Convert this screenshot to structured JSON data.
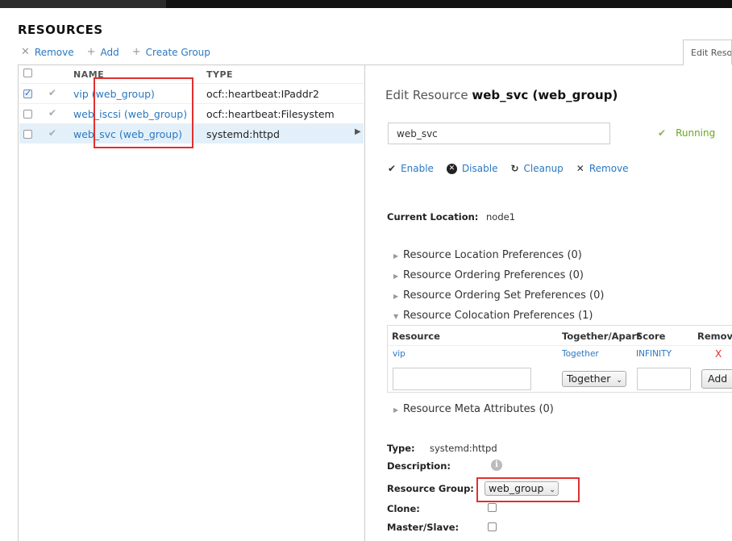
{
  "page": {
    "title": "RESOURCES"
  },
  "toolbar": {
    "remove_label": "Remove",
    "add_label": "Add",
    "create_group_label": "Create Group"
  },
  "tab": {
    "label": "Edit Resou"
  },
  "list": {
    "headers": {
      "name": "NAME",
      "type": "TYPE"
    },
    "rows": [
      {
        "name": "vip (web_group)",
        "type": "ocf::heartbeat:IPaddr2",
        "checked": true,
        "selected": false
      },
      {
        "name": "web_iscsi (web_group)",
        "type": "ocf::heartbeat:Filesystem",
        "checked": false,
        "selected": false
      },
      {
        "name": "web_svc (web_group)",
        "type": "systemd:httpd",
        "checked": false,
        "selected": true
      }
    ]
  },
  "edit": {
    "title_prefix": "Edit Resource ",
    "title_name": "web_svc (web_group)",
    "name_value": "web_svc",
    "status": "Running",
    "actions": {
      "enable": "Enable",
      "disable": "Disable",
      "cleanup": "Cleanup",
      "remove": "Remove"
    },
    "current_location_label": "Current Location:",
    "current_location_value": "node1",
    "prefs": {
      "location": "Resource Location Preferences (0)",
      "ordering": "Resource Ordering Preferences (0)",
      "ordering_set": "Resource Ordering Set Preferences (0)",
      "colocation": "Resource Colocation Preferences (1)",
      "meta": "Resource Meta Attributes (0)"
    },
    "colocation_table": {
      "headers": {
        "resource": "Resource",
        "together": "Together/Apart",
        "score": "Score",
        "remove": "Remove"
      },
      "row": {
        "resource": "vip",
        "together": "Together",
        "score": "INFINITY",
        "remove": "X"
      },
      "new_select": "Together",
      "add_button": "Add"
    },
    "type_label": "Type:",
    "type_value": "systemd:httpd",
    "description_label": "Description:",
    "resource_group_label": "Resource Group:",
    "resource_group_value": "web_group",
    "clone_label": "Clone:",
    "master_slave_label": "Master/Slave:"
  },
  "colors": {
    "link": "#2a78c0",
    "running": "#6aa520",
    "highlight": "#e03030",
    "selected_row": "#e3f0fa"
  }
}
